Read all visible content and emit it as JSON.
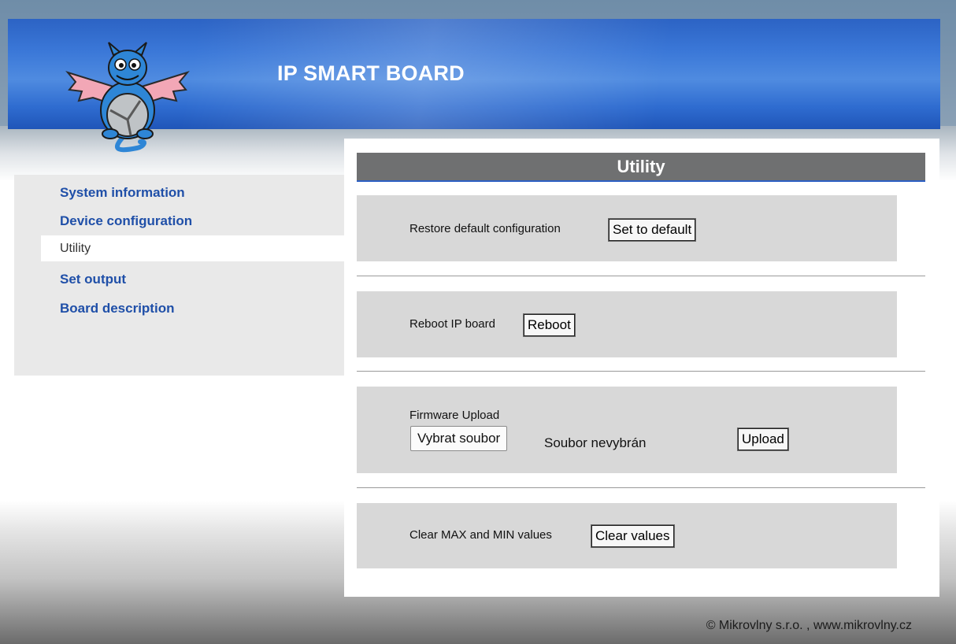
{
  "header": {
    "title": "IP SMART BOARD",
    "logo_icon": "dragon-mascot-icon",
    "colors": {
      "banner": "#3b78d8",
      "banner_dark": "#1f55b8"
    }
  },
  "sidebar": {
    "items": [
      {
        "label": "System information",
        "active": false
      },
      {
        "label": "Device configuration",
        "active": false
      },
      {
        "label": "Utility",
        "active": true
      },
      {
        "label": "Set output",
        "active": false
      },
      {
        "label": "Board description",
        "active": false
      }
    ],
    "colors": {
      "link": "#1f4fa8",
      "active_text": "#333333"
    }
  },
  "main": {
    "title": "Utility",
    "sections": {
      "restore": {
        "label": "Restore default configuration",
        "button": "Set to default"
      },
      "reboot": {
        "label": "Reboot IP board",
        "button": "Reboot"
      },
      "firmware": {
        "label": "Firmware Upload",
        "file_button": "Vybrat soubor",
        "file_status": "Soubor nevybrán",
        "button": "Upload"
      },
      "clear": {
        "label": "Clear MAX and MIN values",
        "button": "Clear values"
      }
    },
    "colors": {
      "title_bar": "#6f7071",
      "title_underline": "#2d5fc3",
      "panel": "#d8d8d8"
    }
  },
  "footer": {
    "text": "© Mikrovlny s.r.o. , www.mikrovlny.cz"
  }
}
